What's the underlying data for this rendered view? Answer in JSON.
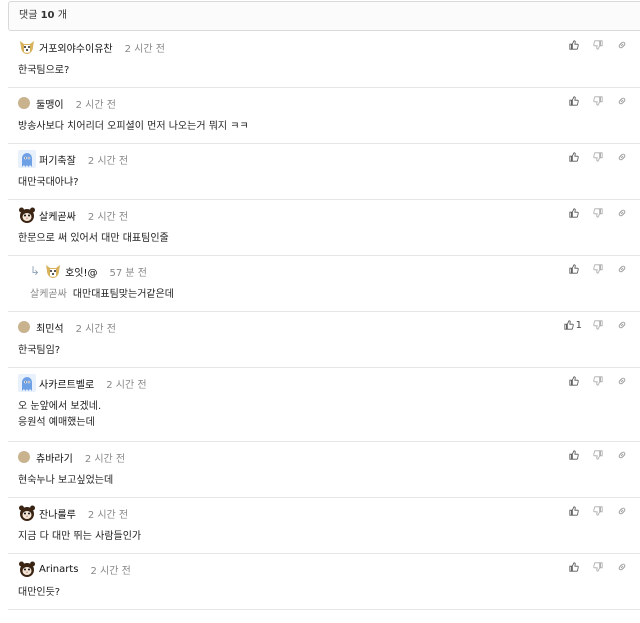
{
  "header": {
    "label": "댓글",
    "count": "10",
    "unit": "개"
  },
  "comments": [
    {
      "author": "거포외야수이유찬",
      "time": "2 시간 전",
      "text": "한국팀으로?",
      "avatar": "puppy",
      "likes": ""
    },
    {
      "author": "둘맹이",
      "time": "2 시간 전",
      "text": "방송사보다 치어리더 오피셜이 먼저 나오는거 뭐지 ㅋㅋ",
      "avatar": "dot",
      "likes": ""
    },
    {
      "author": "퍼기축잘",
      "time": "2 시간 전",
      "text": "대만국대아냐?",
      "avatar": "ghost",
      "likes": ""
    },
    {
      "author": "살케곧싸",
      "time": "2 시간 전",
      "text": "한문으로 써 있어서 대만 대표팀인줄",
      "avatar": "bear",
      "likes": ""
    },
    {
      "author": "호잇!@",
      "time": "57 분 전",
      "mention": "살케곧싸",
      "text": "대만대표팀맞는거같은데",
      "avatar": "puppy",
      "likes": "",
      "reply": true
    },
    {
      "author": "최민석",
      "time": "2 시간 전",
      "text": "한국팀임?",
      "avatar": "dot",
      "likes": "1"
    },
    {
      "author": "사카르트벨로",
      "time": "2 시간 전",
      "text": "오 눈앞에서 보겠네.",
      "text2": "응원석 예매했는데",
      "avatar": "ghost",
      "likes": ""
    },
    {
      "author": "츄바라기",
      "time": "2 시간 전",
      "text": "현숙누나 보고싶었는데",
      "avatar": "dot",
      "likes": ""
    },
    {
      "author": "잔나룰루",
      "time": "2 시간 전",
      "text": "지금 다 대만 뛰는 사람들인가",
      "avatar": "bear",
      "likes": ""
    },
    {
      "author": "Arinarts",
      "time": "2 시간 전",
      "text": "대만인듯?",
      "avatar": "bear",
      "likes": ""
    }
  ],
  "icons": {
    "like": "thumbs-up-icon",
    "dislike": "thumbs-down-icon",
    "share": "link-icon"
  },
  "colors": {
    "border": "#e6e6e6",
    "muted": "#888888",
    "avatar_dot": "#c9b38f"
  }
}
